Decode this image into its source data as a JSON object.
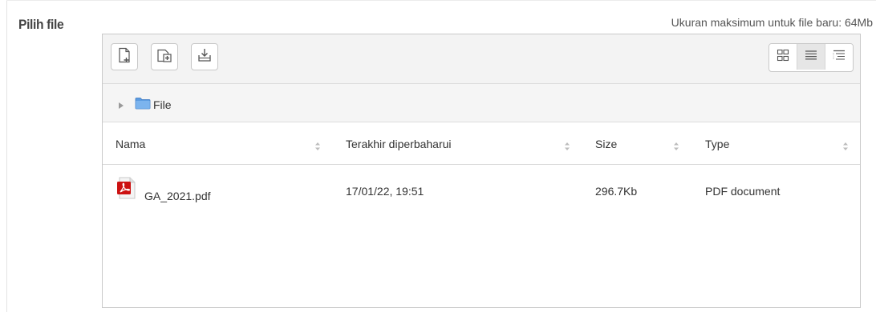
{
  "field": {
    "label": "Pilih file",
    "max_size_text": "Ukuran maksimum untuk file baru: 64Mb"
  },
  "toolbar": {
    "buttons": [
      {
        "name": "add-file",
        "icon": "add-file-icon"
      },
      {
        "name": "create-folder",
        "icon": "create-folder-icon"
      },
      {
        "name": "download-all",
        "icon": "download-icon"
      }
    ],
    "views": [
      {
        "name": "icons-view",
        "icon": "grid-icon",
        "active": false
      },
      {
        "name": "details-view",
        "icon": "list-icon",
        "active": true
      },
      {
        "name": "tree-view",
        "icon": "tree-icon",
        "active": false
      }
    ]
  },
  "path": {
    "folder": "File"
  },
  "table": {
    "headers": [
      "Nama",
      "Terakhir diperbaharui",
      "Size",
      "Type"
    ],
    "rows": [
      {
        "name": "GA_2021.pdf",
        "modified": "17/01/22, 19:51",
        "size": "296.7Kb",
        "type": "PDF document",
        "icon": "pdf-file-icon"
      }
    ]
  },
  "colors": {
    "toolbar_bg": "#f3f3f3",
    "border": "#c9c9c9",
    "folder_blue": "#4a90d9",
    "pdf_red": "#cc1111"
  }
}
